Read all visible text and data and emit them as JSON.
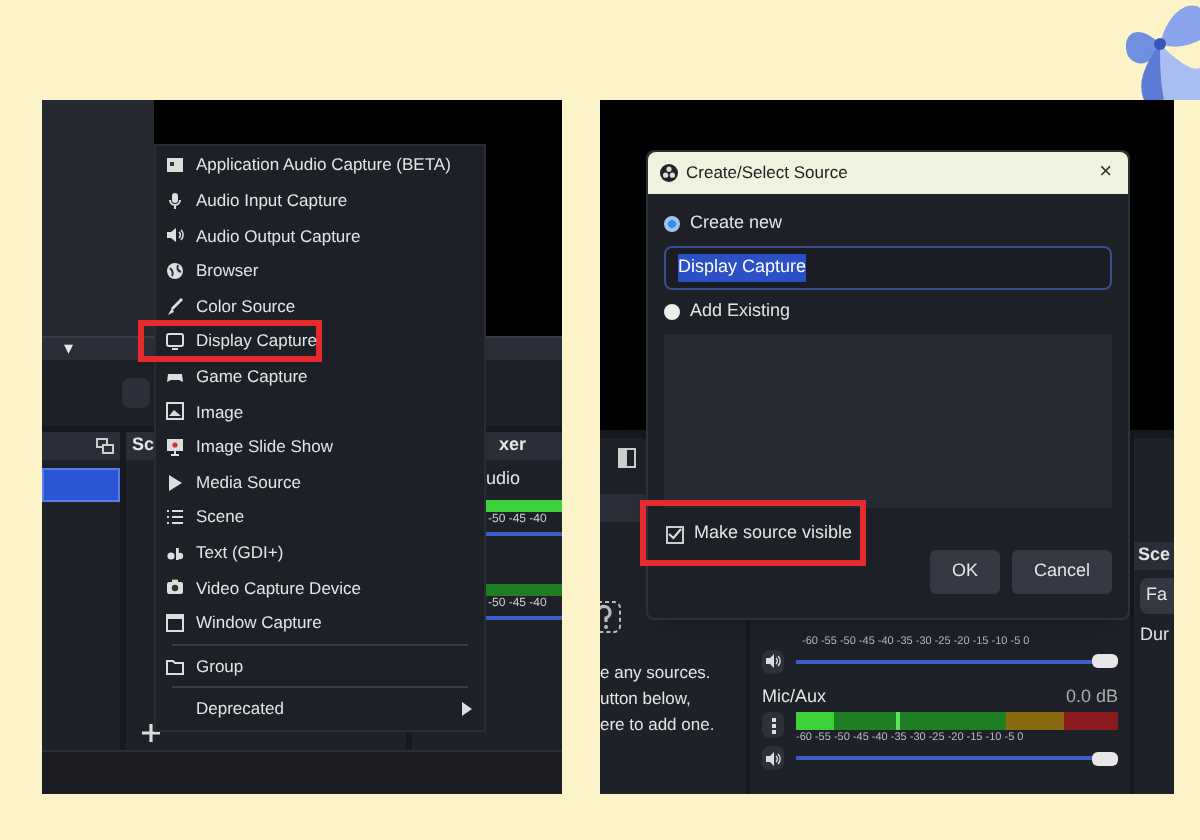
{
  "left_screen": {
    "caret": "▾",
    "scenes_dock": {
      "items": [
        {
          "selected": true
        }
      ]
    },
    "sources_dock": {
      "title": "Sc"
    },
    "mixer_dock": {
      "title": "xer",
      "channel_name": "udio",
      "meters": [
        {
          "kind": "bright",
          "ticks": "-50 -45 -40"
        },
        {
          "kind": "dim",
          "ticks": "-50 -45 -40"
        }
      ]
    },
    "add_source_menu": {
      "sections": [
        [
          {
            "label": "Application Audio Capture (BETA)",
            "annotated": false
          },
          {
            "label": "Audio Input Capture",
            "annotated": false
          },
          {
            "label": "Audio Output Capture",
            "annotated": false
          },
          {
            "label": "Browser",
            "annotated": false
          },
          {
            "label": "Color Source",
            "annotated": false
          },
          {
            "label": "Display Capture",
            "annotated": true
          },
          {
            "label": "Game Capture",
            "annotated": false
          },
          {
            "label": "Image",
            "annotated": false
          },
          {
            "label": "Image Slide Show",
            "annotated": false
          },
          {
            "label": "Media Source",
            "annotated": false
          },
          {
            "label": "Scene",
            "annotated": false
          },
          {
            "label": "Text (GDI+)",
            "annotated": false
          },
          {
            "label": "Video Capture Device",
            "annotated": false
          },
          {
            "label": "Window Capture",
            "annotated": false
          }
        ],
        [
          {
            "label": "Group",
            "annotated": false
          }
        ],
        [
          {
            "label": "Deprecated",
            "annotated": false,
            "kind": "submenu"
          }
        ]
      ]
    }
  },
  "right_screen": {
    "sources_hint": [
      "e any sources.",
      "utton below,",
      "ere to add one."
    ],
    "mixer": {
      "top_ticks": "-60 -55 -50 -45 -40 -35 -30 -25 -20 -15 -10 -5 0",
      "top_volume": {
        "level": 1
      },
      "channel": {
        "name": "Mic/Aux",
        "reading": "0.0 dB",
        "level": 0.12,
        "ticks": "-60 -55 -50 -45 -40 -35 -30 -25 -20 -15 -10 -5 0",
        "volume": {
          "level": 1
        }
      }
    },
    "transitions": {
      "title": "Sce",
      "button": "Fa",
      "duration_label": "Dur"
    },
    "dialog": {
      "title": "Create/Select Source",
      "close": "×",
      "options": [
        {
          "label": "Create new",
          "selected": true
        },
        {
          "label": "Add Existing",
          "selected": false
        }
      ],
      "name_field": {
        "value": "Display Capture",
        "text_selected": true
      },
      "visible_checkbox": {
        "label": "Make source visible",
        "checked": true,
        "annotated": true
      },
      "buttons": [
        "OK",
        "Cancel"
      ]
    }
  }
}
